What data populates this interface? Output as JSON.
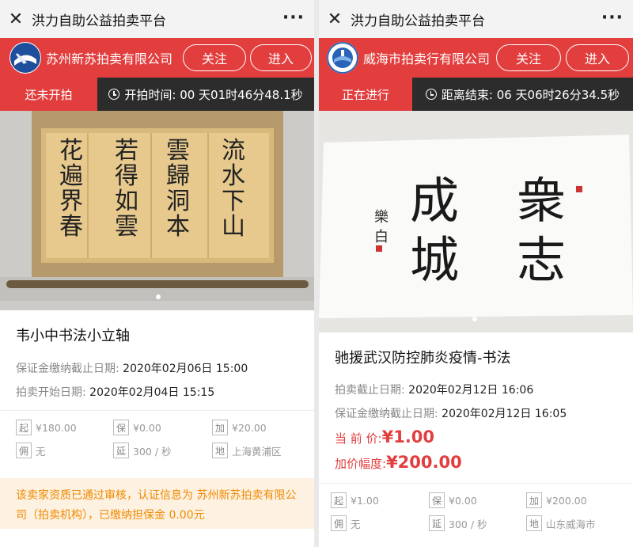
{
  "left": {
    "window": {
      "title": "洪力自助公益拍卖平台",
      "close_icon": "close-icon",
      "more_icon": "more-icon"
    },
    "seller": {
      "name": "苏州新苏拍卖有限公司",
      "follow_label": "关注",
      "enter_label": "进入"
    },
    "status": {
      "tag": "还未开拍",
      "timer_text": "开拍时间: 00 天01时46分48.1秒"
    },
    "item": {
      "title": "韦小中书法小立轴",
      "rows": [
        {
          "label": "保证金缴纳截止日期: ",
          "value": "2020年02月06日 15:00"
        },
        {
          "label": "拍卖开始日期: ",
          "value": "2020年02月04日 15:15"
        }
      ]
    },
    "props": [
      {
        "icon": "起",
        "text": "¥180.00"
      },
      {
        "icon": "保",
        "text": "¥0.00"
      },
      {
        "icon": "加",
        "text": "¥20.00"
      },
      {
        "icon": "佣",
        "text": "无"
      },
      {
        "icon": "延",
        "text": "300 / 秒"
      },
      {
        "icon": "地",
        "text": "上海黄浦区"
      }
    ],
    "notice": "该卖家资质已通过审核，认证信息为 苏州新苏拍卖有限公司（拍卖机构），已缴纳担保金 0.00元"
  },
  "right": {
    "window": {
      "title": "洪力自助公益拍卖平台",
      "close_icon": "close-icon",
      "more_icon": "more-icon"
    },
    "seller": {
      "name": "威海市拍卖行有限公司",
      "follow_label": "关注",
      "enter_label": "进入"
    },
    "status": {
      "tag": "正在进行",
      "timer_text": "距离结束: 06 天06时26分34.5秒"
    },
    "item": {
      "title": "驰援武汉防控肺炎疫情-书法",
      "rows": [
        {
          "label": "拍卖截止日期: ",
          "value": "2020年02月12日 16:06"
        },
        {
          "label": "保证金缴纳截止日期: ",
          "value": "2020年02月12日 16:05"
        }
      ],
      "current_price_label": "当 前 价: ",
      "current_price": "¥1.00",
      "increment_label": "加价幅度: ",
      "increment": "¥200.00"
    },
    "props": [
      {
        "icon": "起",
        "text": "¥1.00"
      },
      {
        "icon": "保",
        "text": "¥0.00"
      },
      {
        "icon": "加",
        "text": "¥200.00"
      },
      {
        "icon": "佣",
        "text": "无"
      },
      {
        "icon": "延",
        "text": "300 / 秒"
      },
      {
        "icon": "地",
        "text": "山东威海市"
      }
    ]
  },
  "colors": {
    "brand_red": "#e23e3e",
    "status_dark": "#2c2c2c",
    "notice_text": "#f08a00",
    "notice_bg": "#fdf1e2"
  }
}
